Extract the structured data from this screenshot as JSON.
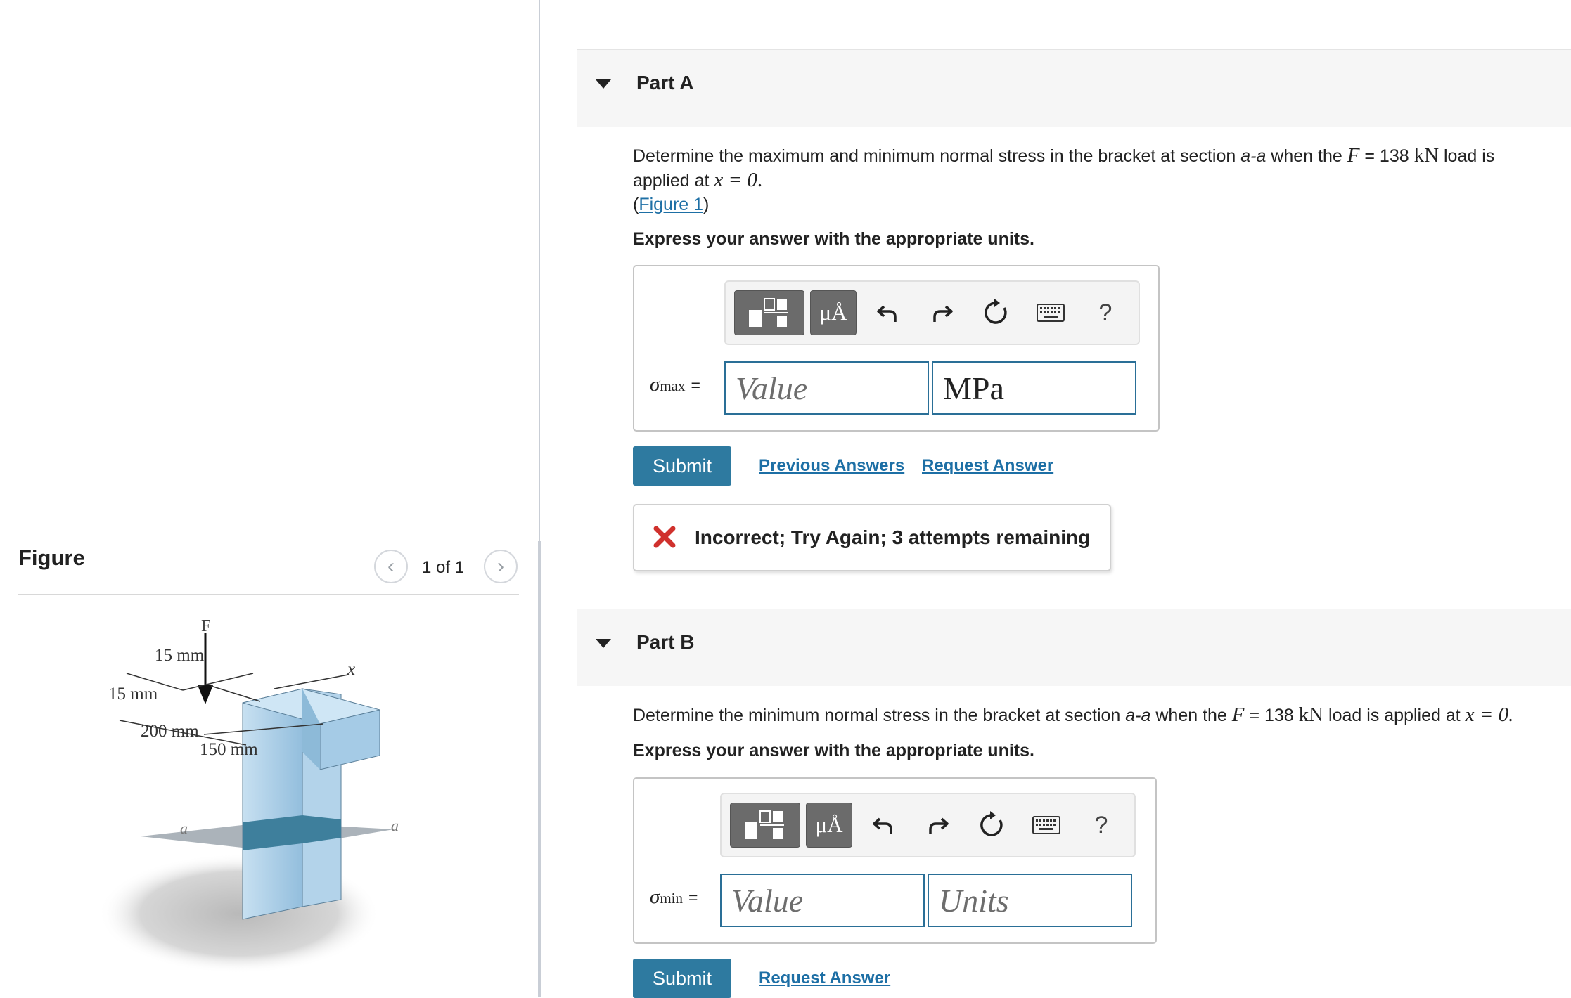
{
  "figure_panel": {
    "heading": "Figure",
    "pager_prev_glyph": "‹",
    "pager_next_glyph": "›",
    "pager_count": "1 of 1",
    "diagram_labels": {
      "force": "F",
      "dim_15_top": "15 mm",
      "dim_15_left": "15 mm",
      "dim_200": "200 mm",
      "dim_150": "150 mm",
      "axis_x": "x",
      "section_left": "a",
      "section_right": "a"
    }
  },
  "part_a": {
    "title": "Part A",
    "question_1": "Determine the maximum and minimum normal stress in the bracket at section ",
    "section_ref": "a-a",
    "question_2": " when the ",
    "force_symbol": "F",
    "force_eq": " = 138 ",
    "force_unit": "kN",
    "question_3": " load is",
    "question_line2_1": "applied at ",
    "x_condition": "x = 0",
    "question_line2_2": ".",
    "figure_paren_open": "(",
    "figure_link": "Figure 1",
    "figure_paren_close": ")",
    "instruction": "Express your answer with the appropriate units.",
    "toolbar": {
      "units_label": "μÅ",
      "undo_icon": "undo-icon",
      "redo_icon": "redo-icon",
      "reset_icon": "reset-icon",
      "keyboard_icon": "keyboard-icon",
      "help_label": "?"
    },
    "var_symbol": "σ",
    "var_sub": "max",
    "equals": "=",
    "value_placeholder": "Value",
    "units_value": "MPa",
    "submit_label": "Submit",
    "previous_answers": "Previous Answers",
    "request_answer": "Request Answer",
    "feedback": "Incorrect; Try Again; 3 attempts remaining"
  },
  "part_b": {
    "title": "Part B",
    "question_1": "Determine the minimum normal stress in the bracket at section ",
    "section_ref": "a-a",
    "question_2": " when the ",
    "force_symbol": "F",
    "force_eq": " = 138 ",
    "force_unit": "kN",
    "question_3": " load is applied at ",
    "x_condition": "x = 0.",
    "instruction": "Express your answer with the appropriate units.",
    "toolbar": {
      "units_label": "μÅ",
      "help_label": "?"
    },
    "var_symbol": "σ",
    "var_sub": "min",
    "equals": "=",
    "value_placeholder": "Value",
    "units_placeholder": "Units",
    "submit_label": "Submit",
    "request_answer": "Request Answer"
  },
  "colors": {
    "accent": "#2e7aa0",
    "link": "#1d6fa5",
    "error": "#d0312d",
    "bracket_face": "#a9cde6",
    "section_band": "#3e7f9c"
  }
}
